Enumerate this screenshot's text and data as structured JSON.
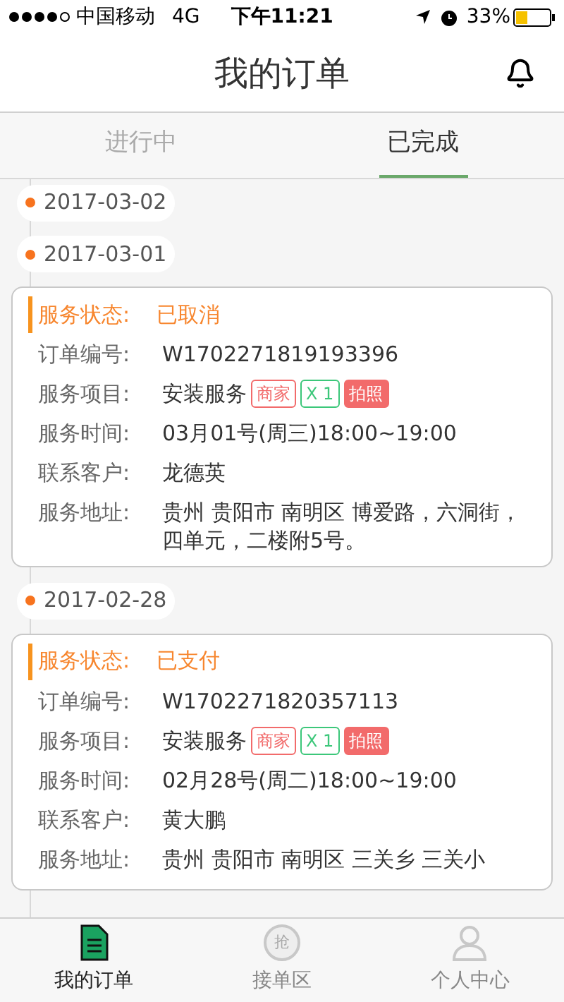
{
  "status_bar": {
    "carrier": "中国移动",
    "network": "4G",
    "time": "下午11:21",
    "battery": "33%"
  },
  "header": {
    "title": "我的订单"
  },
  "tabs": [
    {
      "label": "进行中",
      "selected": false
    },
    {
      "label": "已完成",
      "selected": true
    }
  ],
  "timeline": [
    {
      "date": "2017-03-02"
    },
    {
      "date": "2017-03-01",
      "orders": [
        {
          "status_label": "服务状态:",
          "status": "已取消",
          "rows": [
            {
              "label": "订单编号:",
              "value": "W1702271819193396"
            },
            {
              "label": "服务项目:",
              "value": "安装服务",
              "tags": [
                {
                  "kind": "outline",
                  "text": "商家",
                  "color": "#f26b6b"
                },
                {
                  "kind": "outline",
                  "text": "X 1",
                  "color": "#3cc77a"
                },
                {
                  "kind": "filled",
                  "text": "拍照",
                  "color": "#f26b6b"
                }
              ]
            },
            {
              "label": "服务时间:",
              "value": "03月01号(周三)18:00~19:00"
            },
            {
              "label": "联系客户:",
              "value": "龙德英"
            },
            {
              "label": "服务地址:",
              "value": "贵州 贵阳市 南明区  博爱路，六洞街，四单元，二楼附5号。"
            }
          ]
        }
      ]
    },
    {
      "date": "2017-02-28",
      "orders": [
        {
          "status_label": "服务状态:",
          "status": "已支付",
          "rows": [
            {
              "label": "订单编号:",
              "value": "W1702271820357113"
            },
            {
              "label": "服务项目:",
              "value": "安装服务",
              "tags": [
                {
                  "kind": "outline",
                  "text": "商家",
                  "color": "#f26b6b"
                },
                {
                  "kind": "outline",
                  "text": "X 1",
                  "color": "#3cc77a"
                },
                {
                  "kind": "filled",
                  "text": "拍照",
                  "color": "#f26b6b"
                }
              ]
            },
            {
              "label": "服务时间:",
              "value": "02月28号(周二)18:00~19:00"
            },
            {
              "label": "联系客户:",
              "value": "黄大鹏"
            },
            {
              "label": "服务地址:",
              "value": "贵州 贵阳市 南明区 三关乡 三关小"
            }
          ]
        }
      ]
    }
  ],
  "bottom_tabs": [
    {
      "kind": "document",
      "label": "我的订单",
      "selected": true
    },
    {
      "kind": "grab",
      "label": "接单区",
      "icon_text": "抢",
      "selected": false
    },
    {
      "kind": "person",
      "label": "个人中心",
      "selected": false
    }
  ]
}
